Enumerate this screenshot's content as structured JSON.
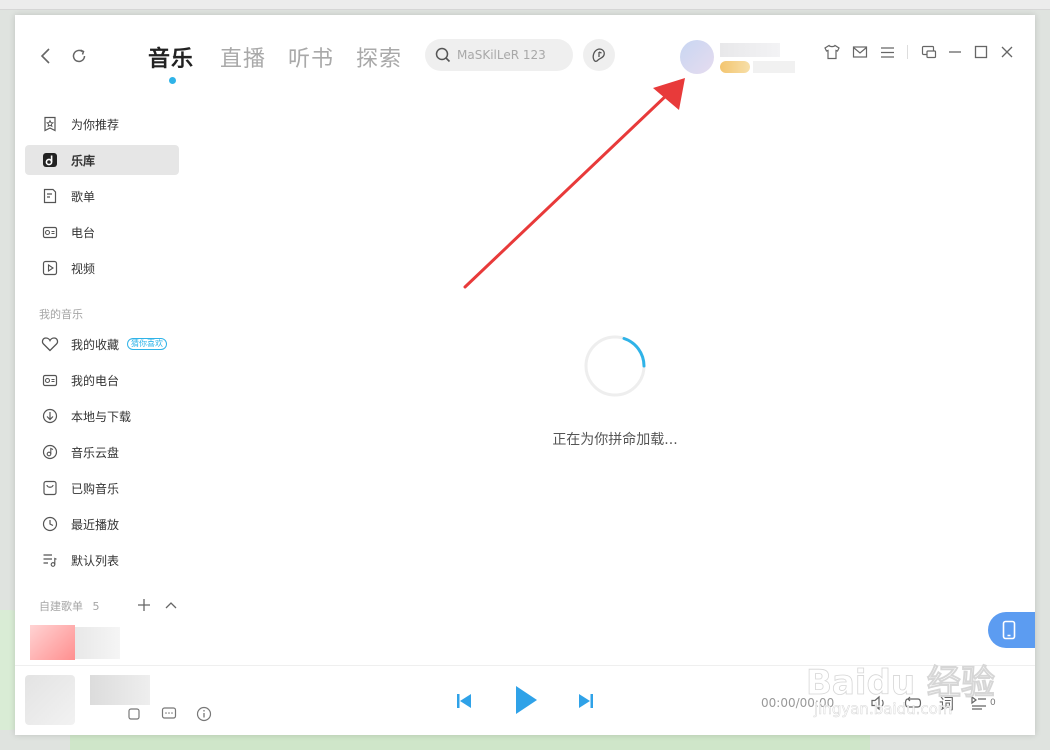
{
  "header": {
    "tabs": [
      {
        "label": "音乐",
        "active": true
      },
      {
        "label": "直播",
        "active": false
      },
      {
        "label": "听书",
        "active": false
      },
      {
        "label": "探索",
        "active": false
      }
    ],
    "search_placeholder": "MaSKilLeR 123"
  },
  "sidebar": {
    "items": [
      {
        "label": "为你推荐",
        "icon": "star-box-icon"
      },
      {
        "label": "乐库",
        "icon": "music-library-icon",
        "active": true
      },
      {
        "label": "歌单",
        "icon": "playlist-doc-icon"
      },
      {
        "label": "电台",
        "icon": "radio-icon"
      },
      {
        "label": "视频",
        "icon": "video-play-icon"
      }
    ],
    "my_music_title": "我的音乐",
    "my_music": [
      {
        "label": "我的收藏",
        "icon": "heart-icon",
        "tag": "猜你喜欢"
      },
      {
        "label": "我的电台",
        "icon": "radio-icon"
      },
      {
        "label": "本地与下载",
        "icon": "download-icon"
      },
      {
        "label": "音乐云盘",
        "icon": "cloud-disk-icon"
      },
      {
        "label": "已购音乐",
        "icon": "purchased-icon"
      },
      {
        "label": "最近播放",
        "icon": "clock-icon"
      },
      {
        "label": "默认列表",
        "icon": "list-music-icon"
      }
    ],
    "created_playlists_title": "自建歌单",
    "created_playlists_count": "5"
  },
  "main": {
    "loading_text": "正在为你拼命加载..."
  },
  "player": {
    "time": "00:00/00:00",
    "lyric_label": "词",
    "queue_count": "0"
  },
  "watermark": {
    "brand": "Baidu 经验",
    "url": "jingyan.baidu.com"
  },
  "colors": {
    "accent": "#2fb3e8",
    "annotation_arrow": "#e83a3a",
    "phone_button": "#5c9cf1"
  }
}
